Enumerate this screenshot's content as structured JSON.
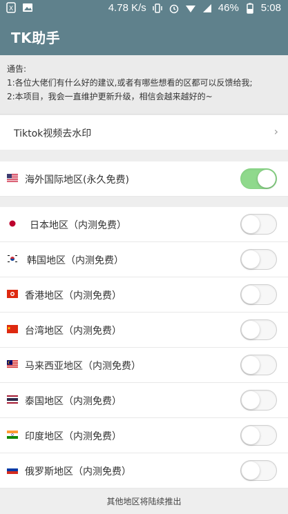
{
  "status": {
    "speed": "4.78 K/s",
    "battery": "46%",
    "time": "5:08"
  },
  "app": {
    "title": "TK助手"
  },
  "notice": {
    "line1": "通告:",
    "line2": "1:各位大佬们有什么好的建议,或者有哪些想看的区都可以反馈给我;",
    "line3": "2:本项目，我会一直维护更新升级，相信会越来越好的~"
  },
  "link": {
    "label": "Tiktok视频去水印",
    "chevron": "›"
  },
  "overseas": {
    "label": "海外国际地区(永久免费)",
    "enabled": true
  },
  "regions": [
    {
      "label": "日本地区（内测免费）",
      "enabled": false
    },
    {
      "label": "韩国地区（内测免费）",
      "enabled": false
    },
    {
      "label": "香港地区（内测免费）",
      "enabled": false
    },
    {
      "label": "台湾地区（内测免费）",
      "enabled": false
    },
    {
      "label": "马来西亚地区（内测免费）",
      "enabled": false
    },
    {
      "label": "泰国地区（内测免费）",
      "enabled": false
    },
    {
      "label": "印度地区（内测免费）",
      "enabled": false
    },
    {
      "label": "俄罗斯地区（内测免费）",
      "enabled": false
    }
  ],
  "footer": {
    "text": "其他地区将陆续推出"
  },
  "colors": {
    "appbar": "#5f818c",
    "toggle_on": "#8fd98c"
  }
}
